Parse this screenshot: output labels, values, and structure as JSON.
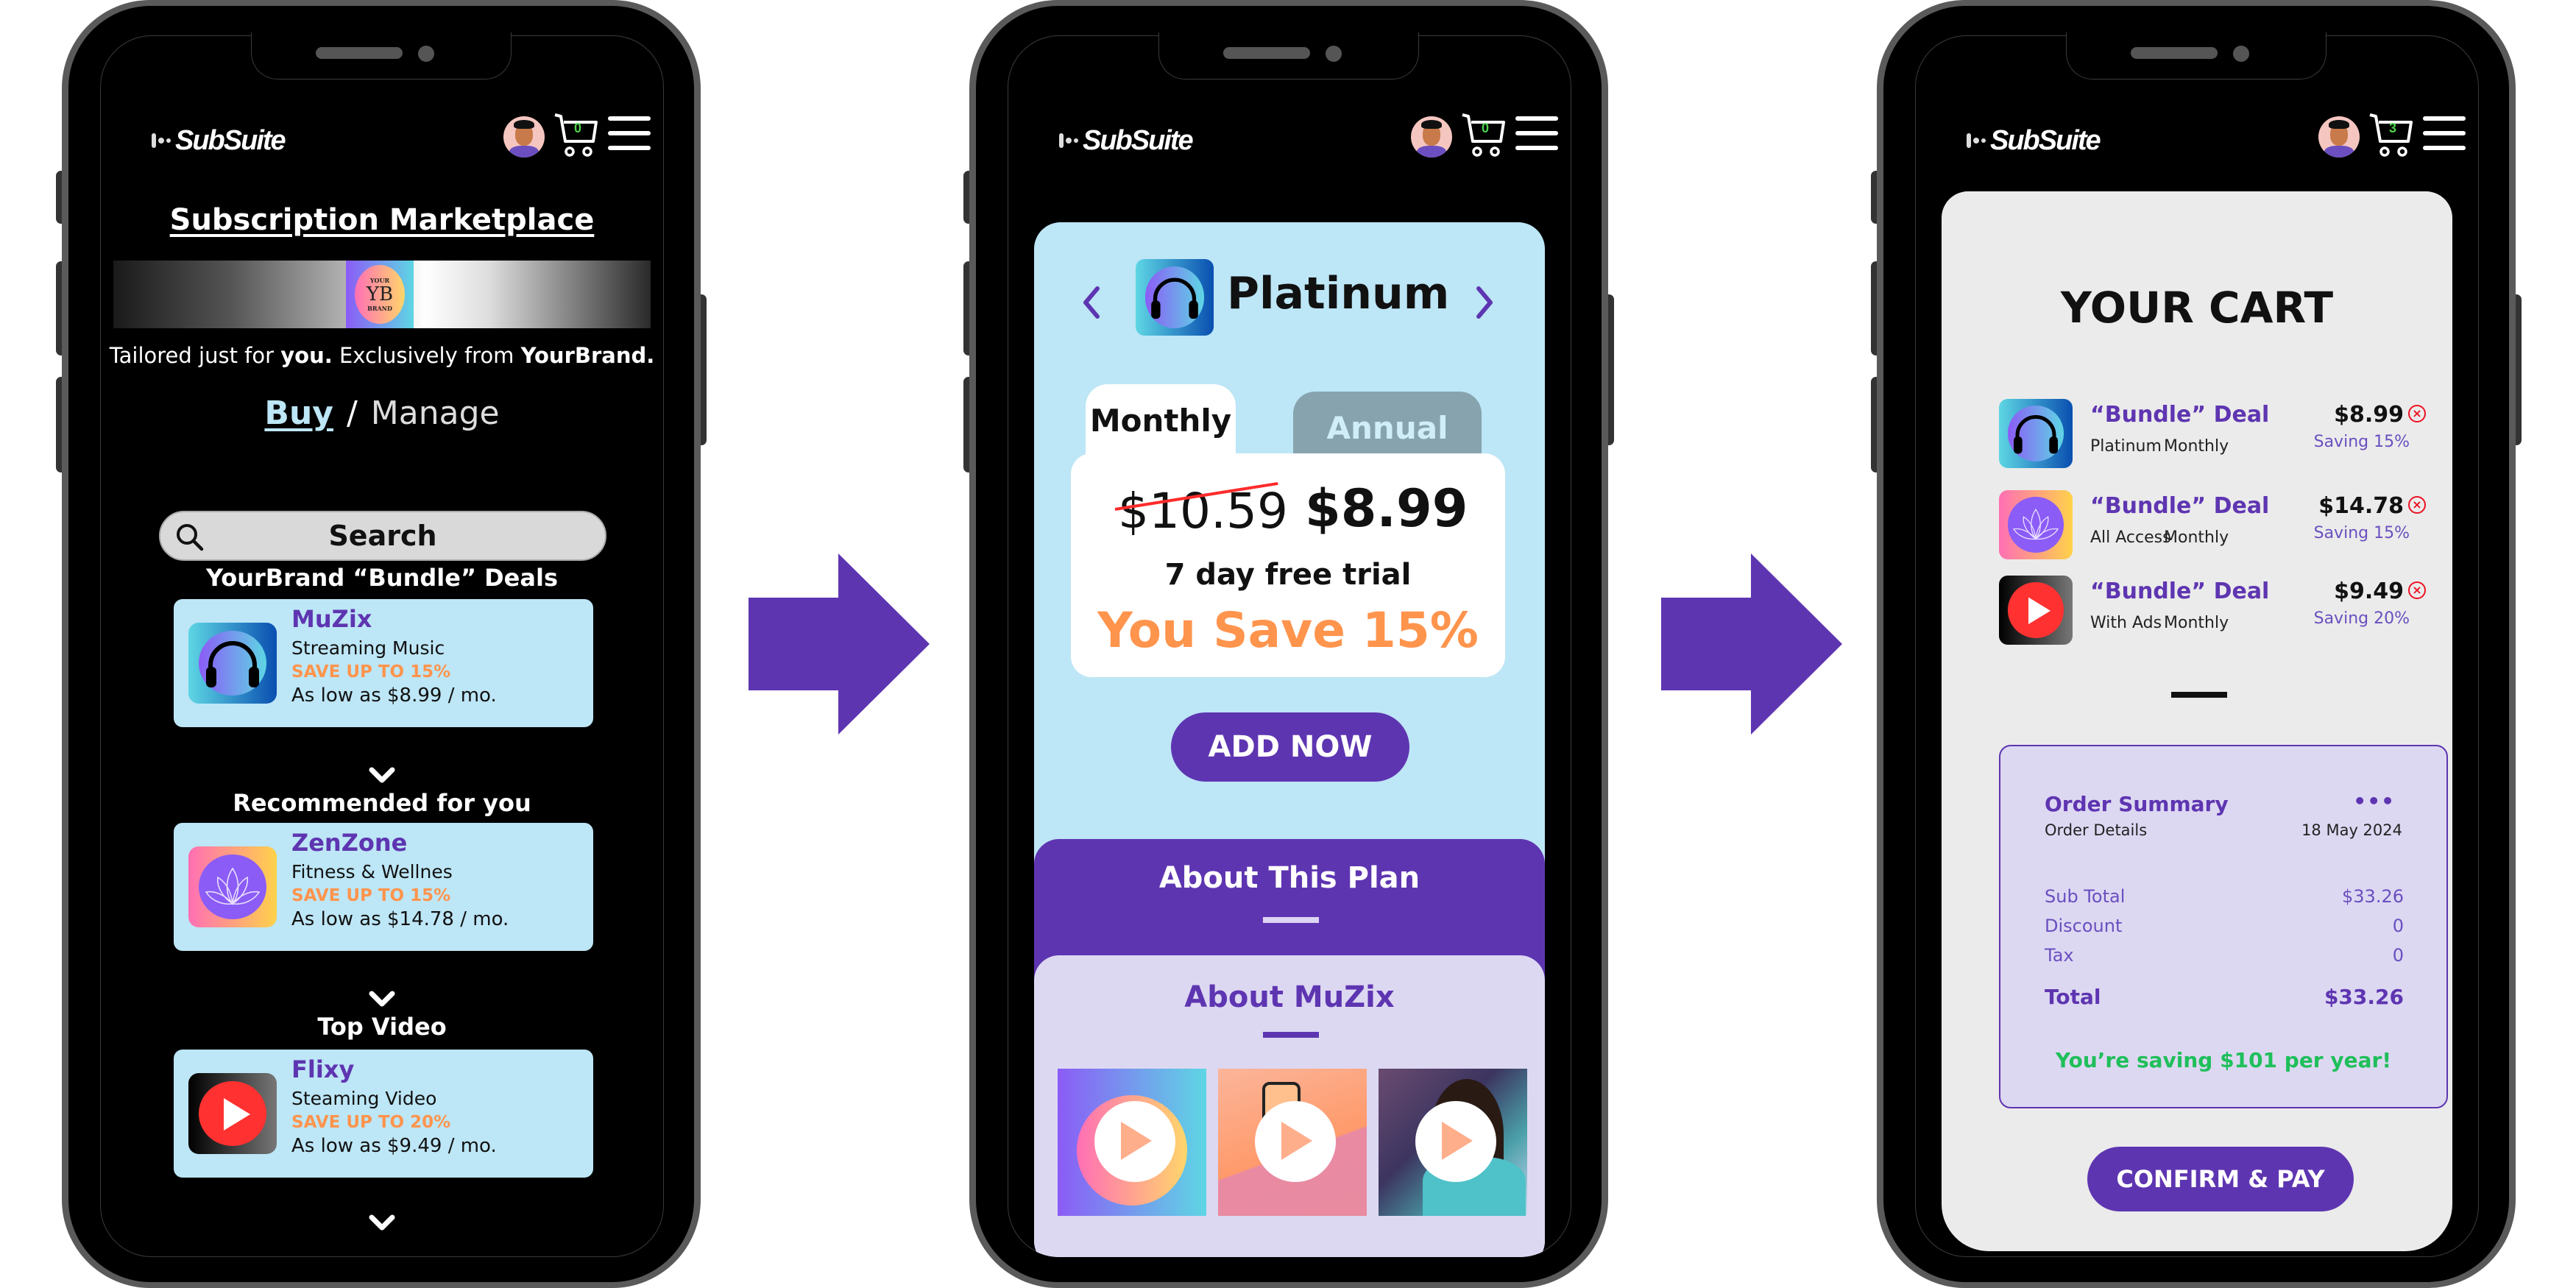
{
  "app": {
    "brand": "SubSuite"
  },
  "header": {
    "avatar_icon": "user-avatar",
    "cart_icon": "shopping-cart-icon",
    "menu_icon": "hamburger-menu-icon"
  },
  "screens": [
    {
      "name": "marketplace",
      "cart_count": "0",
      "title": "Subscription Marketplace",
      "banner": {
        "badge_top": "YOUR",
        "badge_mark": "YB",
        "badge_bottom": "BRAND"
      },
      "tagline": {
        "p1": "Tailored just for ",
        "b1": "you.",
        "p2": " Exclusively from ",
        "b2": "YourBrand."
      },
      "toggle": {
        "buy": "Buy",
        "sep": "/",
        "manage": "Manage"
      },
      "search": {
        "placeholder": "Search",
        "icon": "search-icon"
      },
      "sections": [
        {
          "heading": "YourBrand “Bundle” Deals",
          "card": {
            "name": "MuZix",
            "category": "Streaming Music",
            "save": "SAVE UP TO 15%",
            "price": "As low as $8.99 / mo.",
            "icon": "headphones-icon"
          }
        },
        {
          "heading": "Recommended for you",
          "card": {
            "name": "ZenZone",
            "category": "Fitness & Wellnes",
            "save": "SAVE UP TO 15%",
            "price": "As low as $14.78 / mo.",
            "icon": "lotus-icon"
          }
        },
        {
          "heading": "Top Video",
          "card": {
            "name": "Flixy",
            "category": "Steaming Video",
            "save": "SAVE UP TO 20%",
            "price": "As low as $9.49 / mo.",
            "icon": "play-icon"
          }
        }
      ]
    },
    {
      "name": "plan-detail",
      "cart_count": "0",
      "plan_name": "Platinum",
      "plan_icon": "headphones-icon",
      "tabs": [
        {
          "label": "Monthly",
          "active": true
        },
        {
          "label": "Annual",
          "active": false
        }
      ],
      "old_price": "$10.59",
      "new_price": "$8.99",
      "trial": "7 day free trial",
      "you_save": "You Save 15%",
      "add_button": "ADD NOW",
      "about_plan": "About This Plan",
      "about_app": "About MuZix",
      "media": [
        {
          "label": "brand-promo-video"
        },
        {
          "label": "phone-promo-video"
        },
        {
          "label": "lifestyle-video"
        }
      ]
    },
    {
      "name": "cart",
      "cart_count": "3",
      "title": "YOUR CART",
      "items": [
        {
          "deal": "“Bundle” Deal",
          "plan": "Platinum",
          "freq": "Monthly",
          "price": "$8.99",
          "saving": "Saving 15%",
          "icon": "headphones-icon"
        },
        {
          "deal": "“Bundle” Deal",
          "plan": "All Access",
          "freq": "Monthly",
          "price": "$14.78",
          "saving": "Saving 15%",
          "icon": "lotus-icon"
        },
        {
          "deal": "“Bundle” Deal",
          "plan": "With Ads",
          "freq": "Monthly",
          "price": "$9.49",
          "saving": "Saving 20%",
          "icon": "play-icon"
        }
      ],
      "remove_symbol": "×",
      "summary": {
        "title": "Order Summary",
        "more": "•••",
        "subtitle": "Order Details",
        "date": "18 May 2024",
        "rows": [
          {
            "label": "Sub Total",
            "value": "$33.26"
          },
          {
            "label": "Discount",
            "value": "0"
          },
          {
            "label": "Tax",
            "value": "0"
          }
        ],
        "total_label": "Total",
        "total_value": "$33.26",
        "saving_note": "You’re saving $101 per year!"
      },
      "pay_button": "CONFIRM & PAY"
    }
  ],
  "colors": {
    "accent_purple": "#5e35b1",
    "card_blue": "#bde6f6",
    "save_orange": "#ff944d",
    "success_green": "#1fbf5a",
    "cart_count_green": "#4fd34f",
    "remove_red": "#ee1122"
  }
}
